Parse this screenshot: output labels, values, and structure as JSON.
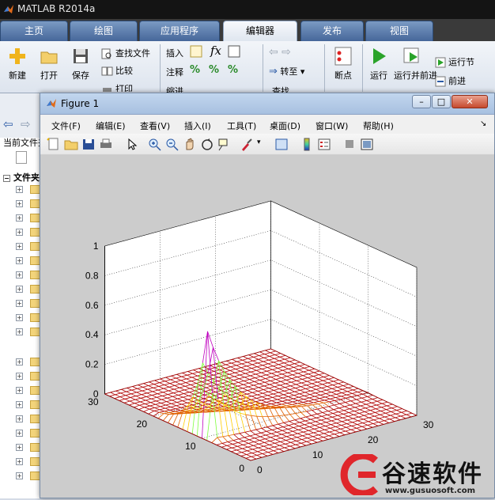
{
  "app": {
    "title": "MATLAB R2014a"
  },
  "tabs": [
    "主页",
    "绘图",
    "应用程序",
    "编辑器",
    "发布",
    "视图"
  ],
  "active_tab": "编辑器",
  "ribbon": {
    "new": "新建",
    "open": "打开",
    "save": "保存",
    "find_files": "查找文件",
    "compare": "比较",
    "print": "打印",
    "insert": "插入",
    "comment": "注释",
    "indent": "缩进",
    "goto": "转至",
    "find": "查找",
    "breakpoints": "断点",
    "run": "运行",
    "run_advance": "运行并前进",
    "run_section": "运行节",
    "advance": "前进"
  },
  "left_pane": {
    "current_folder": "当前文件夹",
    "folder_header": "文件夹"
  },
  "figure": {
    "title": "Figure 1",
    "menu": [
      "文件(F)",
      "编辑(E)",
      "查看(V)",
      "插入(I)",
      "工具(T)",
      "桌面(D)",
      "窗口(W)",
      "帮助(H)"
    ]
  },
  "chart_data": {
    "type": "surface-mesh",
    "title": "",
    "xlabel": "",
    "ylabel": "",
    "zlabel": "",
    "x_ticks": [
      0,
      10,
      20,
      30
    ],
    "y_ticks": [
      0,
      10,
      20,
      30
    ],
    "z_ticks": [
      0,
      0.2,
      0.4,
      0.6,
      0.8,
      1
    ],
    "z_tick_labels": [
      "0",
      "0.2",
      "0.4",
      "0.6",
      "0.8",
      "1"
    ],
    "xlim": [
      0,
      30
    ],
    "ylim": [
      0,
      30
    ],
    "zlim": [
      0,
      1
    ],
    "grid": true,
    "peak": {
      "x": 0,
      "y": 10,
      "z": 0.78
    },
    "mesh_colors": [
      "#b00000",
      "#e06000",
      "#ffcc00",
      "#80ff40",
      "#c000c0"
    ]
  },
  "watermark": {
    "brand": "谷速软件",
    "url": "www.gusuosoft.com"
  }
}
